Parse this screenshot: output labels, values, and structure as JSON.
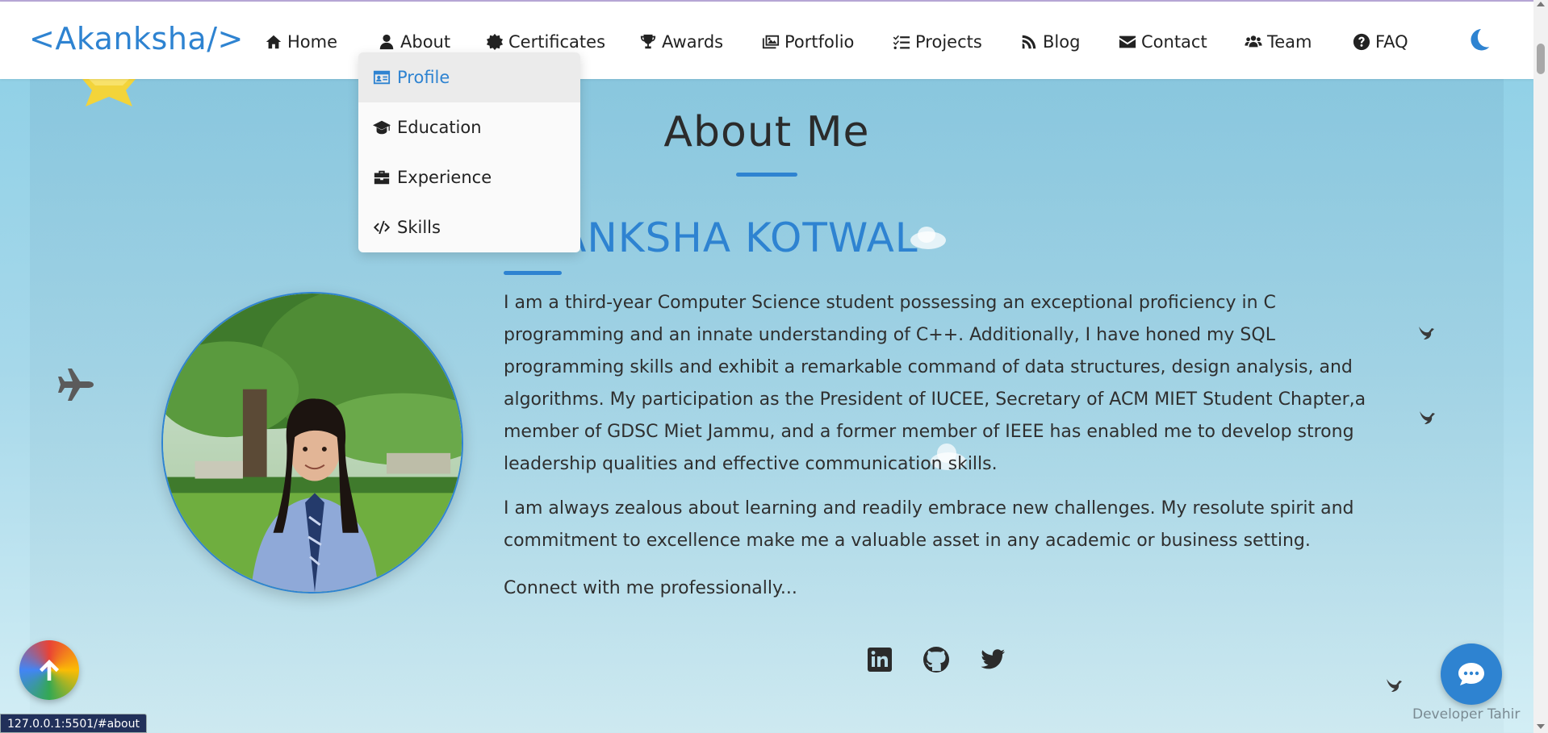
{
  "nav": {
    "logo": "<Akanksha/>",
    "items": [
      {
        "label": "Home",
        "icon": "home-icon"
      },
      {
        "label": "About",
        "icon": "user-icon"
      },
      {
        "label": "Certificates",
        "icon": "certificate-icon"
      },
      {
        "label": "Awards",
        "icon": "trophy-icon"
      },
      {
        "label": "Portfolio",
        "icon": "images-icon"
      },
      {
        "label": "Projects",
        "icon": "list-check-icon"
      },
      {
        "label": "Blog",
        "icon": "blog-icon"
      },
      {
        "label": "Contact",
        "icon": "envelope-icon"
      },
      {
        "label": "Team",
        "icon": "users-icon"
      },
      {
        "label": "FAQ",
        "icon": "question-circle-icon"
      }
    ],
    "theme_toggle_icon": "moon-icon"
  },
  "about_dropdown": {
    "items": [
      {
        "label": "Profile",
        "icon": "id-card-icon",
        "active": true
      },
      {
        "label": "Education",
        "icon": "graduation-cap-icon"
      },
      {
        "label": "Experience",
        "icon": "briefcase-icon"
      },
      {
        "label": "Skills",
        "icon": "code-icon"
      }
    ]
  },
  "about": {
    "title": "About Me",
    "name": "AKANKSHA KOTWAL",
    "paragraphs": [
      "I am a third-year Computer Science student possessing an exceptional proficiency in C programming and an innate understanding of C++. Additionally, I have honed my SQL programming skills and exhibit a remarkable command of data structures, design analysis, and algorithms. My participation as the President of IUCEE, Secretary of ACM MIET Student Chapter,a member of GDSC Miet Jammu, and a former member of IEEE has enabled me to develop strong leadership qualities and effective communication skills.",
      "I am always zealous about learning and readily embrace new challenges. My resolute spirit and commitment to excellence make me a valuable asset in any academic or business setting.",
      "Connect with me professionally..."
    ],
    "social": [
      "linkedin-icon",
      "github-icon",
      "twitter-icon"
    ]
  },
  "floating": {
    "back_to_top_icon": "arrow-up-icon",
    "chat_icon": "chat-icon",
    "developer_credit": "Developer Tahir"
  },
  "status_bar": {
    "url": "127.0.0.1:5501/#about"
  },
  "colors": {
    "accent": "#2e83d1",
    "text": "#2f2f2f",
    "background": "#a6d8ea"
  }
}
